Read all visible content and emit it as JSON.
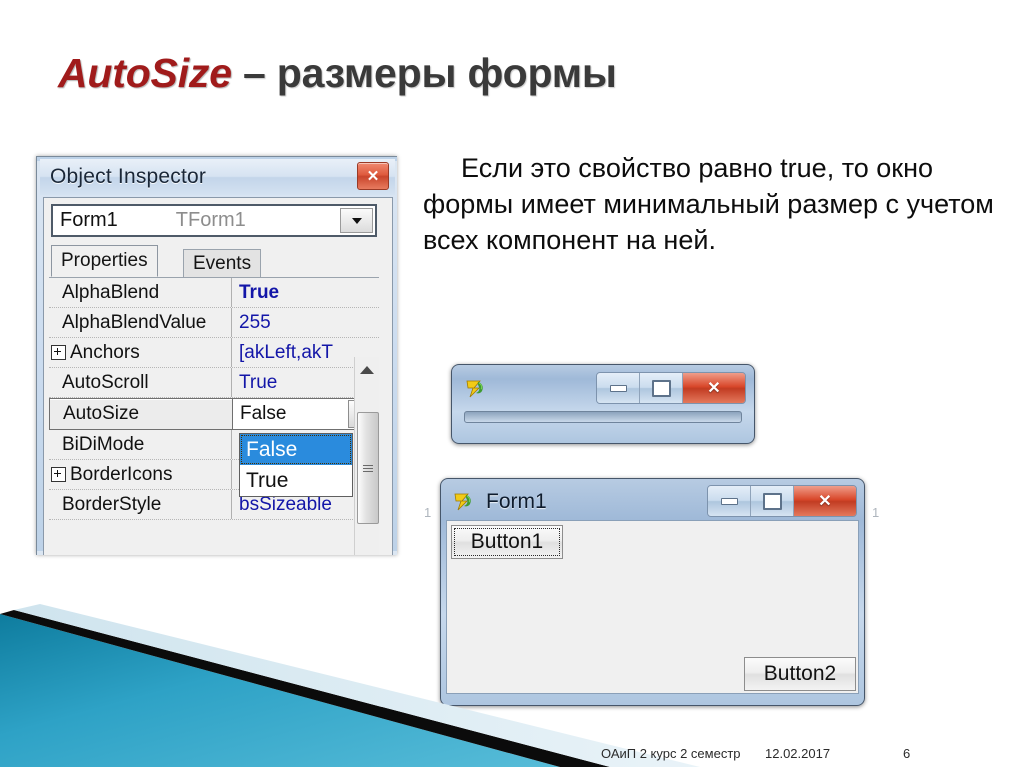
{
  "slide": {
    "title_red": "AutoSize",
    "title_rest": " – размеры формы",
    "body_text": "Если это свойство равно true, то окно формы имеет минимальный размер с учетом всех компонент на ней."
  },
  "object_inspector": {
    "window_title": "Object Inspector",
    "close_glyph": "✕",
    "combo": {
      "object_name": "Form1",
      "class_name": "TForm1",
      "arrow_icon": "chevron-down-icon"
    },
    "tabs": [
      {
        "label": "Properties",
        "active": true
      },
      {
        "label": "Events",
        "active": false
      }
    ],
    "properties": [
      {
        "name": "AlphaBlend",
        "value": "True",
        "expandable": false,
        "bold": true,
        "selected": false
      },
      {
        "name": "AlphaBlendValue",
        "value": "255",
        "expandable": false,
        "bold": false,
        "selected": false
      },
      {
        "name": "Anchors",
        "value": "[akLeft,akT",
        "expandable": true,
        "bold": false,
        "selected": false
      },
      {
        "name": "AutoScroll",
        "value": "True",
        "expandable": false,
        "bold": false,
        "selected": false
      },
      {
        "name": "AutoSize",
        "value": "False",
        "expandable": false,
        "bold": false,
        "selected": true
      },
      {
        "name": "BiDiMode",
        "value": "",
        "expandable": false,
        "bold": false,
        "selected": false
      },
      {
        "name": "BorderIcons",
        "value": "",
        "expandable": true,
        "bold": false,
        "selected": false
      },
      {
        "name": "BorderStyle",
        "value": "bsSizeable",
        "expandable": false,
        "bold": false,
        "selected": false
      }
    ],
    "dropdown": {
      "options": [
        "False",
        "True"
      ],
      "selected": "False"
    },
    "scrollbar": {
      "up_icon": "triangle-up-icon"
    }
  },
  "collapsed_form": {
    "app_icon": "delphi7-icon",
    "minimize_icon": "minimize-icon",
    "maximize_icon": "maximize-icon",
    "close_label": "✕"
  },
  "demo_form": {
    "app_icon": "delphi7-icon",
    "title": "Form1",
    "minimize_icon": "minimize-icon",
    "maximize_icon": "maximize-icon",
    "close_label": "✕",
    "buttons": [
      {
        "label": "Button1"
      },
      {
        "label": "Button2"
      }
    ]
  },
  "footer": {
    "course": "ОАиП 2 курс 2 семестр",
    "date": "12.02.2017",
    "page": "6"
  },
  "colors": {
    "title_red": "#A01B1B",
    "title_dark": "#3A3A3A",
    "accent_teal": "#2E9FC4",
    "value_blue": "#1316A8",
    "selection_blue": "#2A8BDD",
    "close_red": "#D9482B"
  }
}
